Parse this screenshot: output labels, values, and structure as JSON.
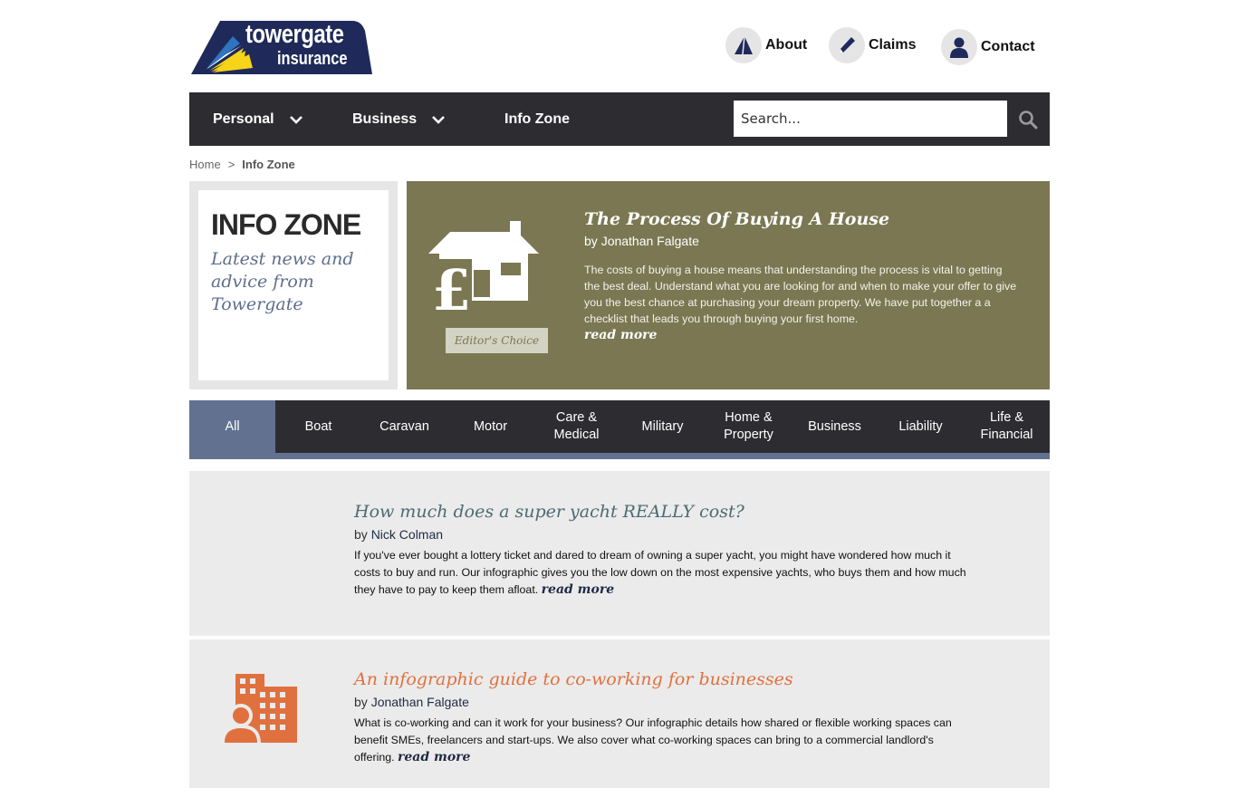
{
  "logo": {
    "line1": "towergate",
    "line2": "insurance"
  },
  "toplinks": [
    {
      "label": "About",
      "icon": "sail-icon"
    },
    {
      "label": "Claims",
      "icon": "pen-icon"
    },
    {
      "label": "Contact",
      "icon": "person-icon"
    }
  ],
  "nav": {
    "items": [
      {
        "label": "Personal",
        "dropdown": true
      },
      {
        "label": "Business",
        "dropdown": true
      },
      {
        "label": "Info Zone",
        "dropdown": false
      }
    ],
    "search_placeholder": "Search..."
  },
  "breadcrumb": {
    "home": "Home",
    "separator": ">",
    "current": "Info Zone"
  },
  "infozone": {
    "title": "INFO ZONE",
    "subtitle": "Latest news and advice from Towergate"
  },
  "featured": {
    "badge": "Editor's Choice",
    "title": "The Process Of Buying A House",
    "by": "by",
    "author": "Jonathan Falgate",
    "description": "The costs of buying a house means that understanding the process is vital to getting the best deal. Understand what you are looking for and when to make your offer to give you the best chance at purchasing your dream property. We have put together a a checklist that leads you through buying your first home.",
    "read_more": "read more"
  },
  "tabs": [
    "All",
    "Boat",
    "Caravan",
    "Motor",
    "Care & Medical",
    "Military",
    "Home & Property",
    "Business",
    "Liability",
    "Life & Financial"
  ],
  "articles": [
    {
      "title": "How much does a super yacht REALLY cost?",
      "by": "by",
      "author": "Nick Colman",
      "description": "If you've ever bought a lottery ticket and dared to dream of owning a super yacht, you might have wondered how much it costs to buy and run. Our infographic gives you the low down on the most expensive yachts, who buys them and how much they have to pay to keep them afloat.",
      "read_more": "read more",
      "title_color": "#4c6b72"
    },
    {
      "title": "An infographic guide to co-working for businesses",
      "by": "by",
      "author": "Jonathan Falgate",
      "description": "What is co-working and can it work for your business? Our infographic details how shared or flexible working spaces can benefit SMEs, freelancers and start-ups. We also cover what co-working spaces can bring to a commercial landlord's offering.",
      "read_more": "read more",
      "title_color": "#e0713f",
      "icon": "office-building-person-icon"
    }
  ],
  "colors": {
    "nav_bg": "#2d2d31",
    "featured_bg": "#7b7752",
    "tab_active": "#627190",
    "brand_navy": "#1f2a5a",
    "accent_orange": "#e0713f"
  }
}
